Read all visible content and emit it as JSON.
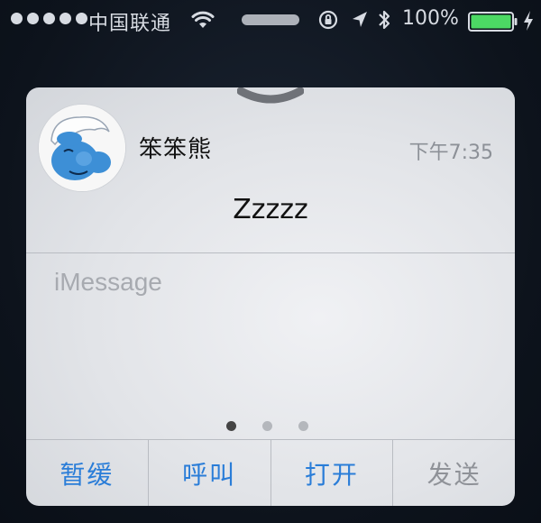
{
  "status_bar": {
    "carrier": "中国联通",
    "battery_percent": "100%",
    "battery_level": 1.0,
    "battery_color": "#4cd964"
  },
  "notification": {
    "sender": "笨笨熊",
    "time": "下午7:35",
    "message": "Zzzzz",
    "avatar_icon": "smurf-avatar-icon"
  },
  "reply": {
    "placeholder": "iMessage",
    "value": ""
  },
  "pager": {
    "count": 3,
    "active": 0
  },
  "actions": {
    "snooze": "暂缓",
    "call": "呼叫",
    "open": "打开",
    "send": "发送"
  },
  "colors": {
    "accent": "#2a7dd8",
    "disabled": "#8f9298"
  }
}
